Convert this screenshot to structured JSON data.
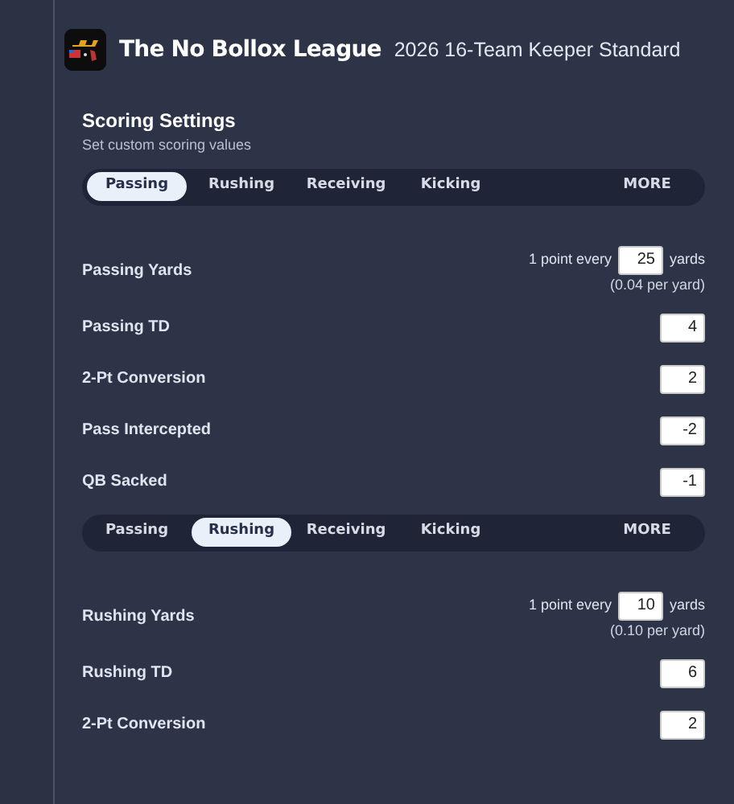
{
  "league": {
    "name": "The No Bollox League",
    "subtitle": "2026 16-Team Keeper Standard"
  },
  "section": {
    "title": "Scoring Settings",
    "subtitle": "Set custom scoring values"
  },
  "groups": [
    {
      "tabs": [
        {
          "label": "Passing",
          "selected": true
        },
        {
          "label": "Rushing",
          "selected": false
        },
        {
          "label": "Receiving",
          "selected": false
        },
        {
          "label": "Kicking",
          "selected": false
        }
      ],
      "more": "MORE",
      "rows": [
        {
          "kind": "per_unit",
          "label": "Passing Yards",
          "prefix": "1 point every",
          "value": "25",
          "suffix": "yards",
          "note": "(0.04 per yard)"
        },
        {
          "kind": "value",
          "label": "Passing TD",
          "value": "4"
        },
        {
          "kind": "value",
          "label": "2-Pt Conversion",
          "value": "2"
        },
        {
          "kind": "value",
          "label": "Pass Intercepted",
          "value": "-2"
        },
        {
          "kind": "value",
          "label": "QB Sacked",
          "value": "-1"
        }
      ]
    },
    {
      "tabs": [
        {
          "label": "Passing",
          "selected": false
        },
        {
          "label": "Rushing",
          "selected": true
        },
        {
          "label": "Receiving",
          "selected": false
        },
        {
          "label": "Kicking",
          "selected": false
        }
      ],
      "more": "MORE",
      "rows": [
        {
          "kind": "per_unit",
          "label": "Rushing Yards",
          "prefix": "1 point every",
          "value": "10",
          "suffix": "yards",
          "note": "(0.10 per yard)"
        },
        {
          "kind": "value",
          "label": "Rushing TD",
          "value": "6"
        },
        {
          "kind": "value",
          "label": "2-Pt Conversion",
          "value": "2"
        }
      ]
    }
  ]
}
